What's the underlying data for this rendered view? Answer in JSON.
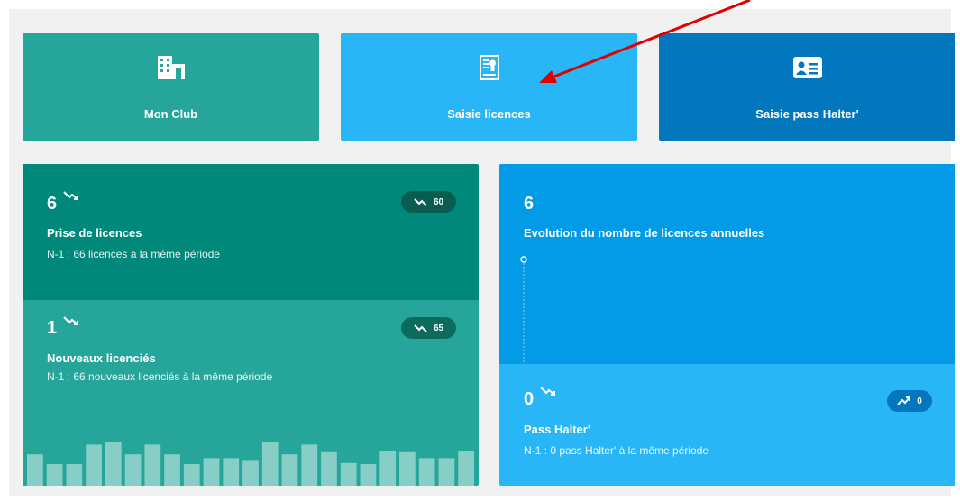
{
  "tiles": [
    {
      "label": "Mon Club",
      "icon": "building-icon"
    },
    {
      "label": "Saisie licences",
      "icon": "license-document-icon"
    },
    {
      "label": "Saisie pass Halter'",
      "icon": "id-card-icon"
    }
  ],
  "licences": {
    "value": "6",
    "trend": "down",
    "title": "Prise de licences",
    "subtitle": "N-1 : 66 licences à la même période",
    "badge": "60",
    "badge_trend": "down"
  },
  "nouveaux": {
    "value": "1",
    "trend": "down",
    "title": "Nouveaux licenciés",
    "subtitle": "N-1 : 66 nouveaux licenciés à la même période",
    "badge": "65",
    "badge_trend": "down"
  },
  "evolution": {
    "value": "6",
    "title": "Evolution du nombre de licences annuelles"
  },
  "pass": {
    "value": "0",
    "trend": "down",
    "title": "Pass Halter'",
    "subtitle": "N-1 : 0 pass Halter' à la même période",
    "badge": "0",
    "badge_trend": "up"
  },
  "colors": {
    "teal_dark": "#00897b",
    "teal": "#26a69a",
    "blue_light": "#29b6f6",
    "blue": "#039be5",
    "blue_dark": "#0277bd",
    "annotation_arrow": "#e00000"
  },
  "chart_data": {
    "type": "bar",
    "title": "",
    "bars": [
      0.58,
      0.4,
      0.4,
      0.76,
      0.8,
      0.58,
      0.76,
      0.58,
      0.4,
      0.51,
      0.51,
      0.46,
      0.8,
      0.58,
      0.76,
      0.62,
      0.42,
      0.4,
      0.64,
      0.62,
      0.51,
      0.51,
      0.65
    ]
  }
}
